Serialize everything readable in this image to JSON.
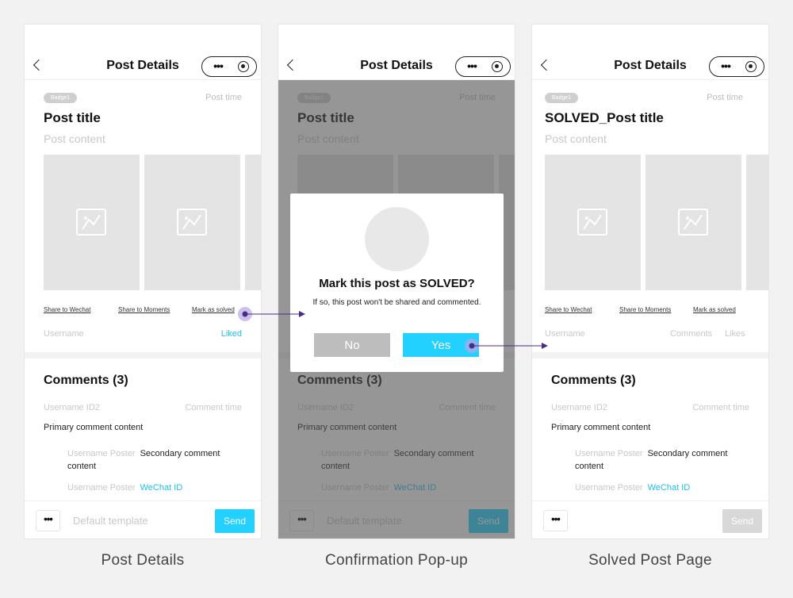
{
  "nav": {
    "title": "Post Details",
    "more_icon": "•••"
  },
  "post": {
    "badge": "Badge1",
    "time": "Post time",
    "title": "Post title",
    "solved_title": "SOLVED_Post title",
    "content": "Post content"
  },
  "actions": {
    "share_wechat": "Share to Wechat",
    "share_moments": "Share to Moments",
    "mark_solved": "Mark as solved"
  },
  "meta": {
    "username": "Username",
    "liked": "Liked",
    "comments": "Comments",
    "likes": "Likes"
  },
  "comments": {
    "title": "Comments (3)",
    "user": "Username ID2",
    "time": "Comment time",
    "primary": "Primary comment content",
    "poster": "Username Poster",
    "secondary": "Secondary comment content",
    "wechat_id": "WeChat ID"
  },
  "bottom_bar": {
    "more_icon": "•••",
    "placeholder": "Default template",
    "send": "Send"
  },
  "dialog": {
    "title": "Mark this post as SOLVED?",
    "subtitle": "If so, this post won't be shared and commented.",
    "no": "No",
    "yes": "Yes"
  },
  "captions": {
    "post_details": "Post Details",
    "confirmation": "Confirmation Pop-up",
    "solved": "Solved Post Page"
  },
  "colors": {
    "accent": "#22d1ff",
    "link_accent": "#22c0f0",
    "connector": "#4b2a8a",
    "disabled": "#d8d8d8"
  }
}
